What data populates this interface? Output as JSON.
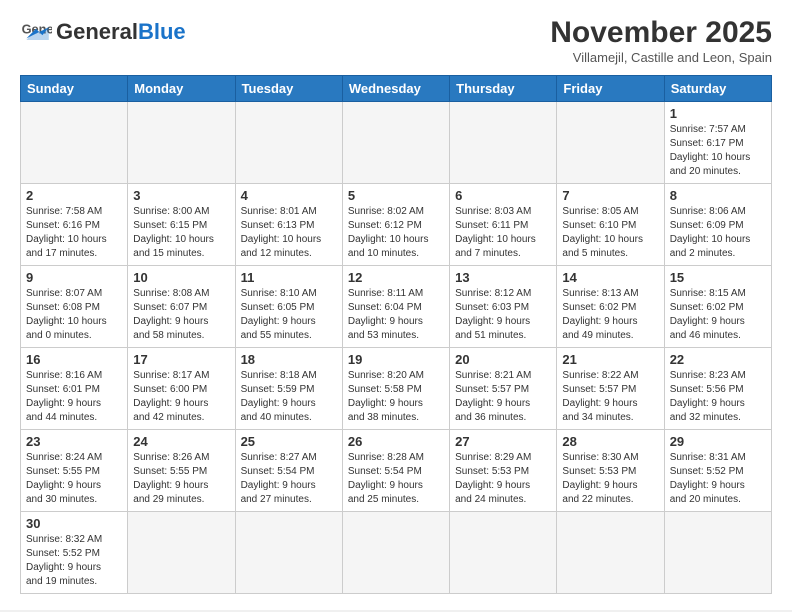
{
  "header": {
    "logo_general": "General",
    "logo_blue": "Blue",
    "month_title": "November 2025",
    "subtitle": "Villamejil, Castille and Leon, Spain"
  },
  "days_of_week": [
    "Sunday",
    "Monday",
    "Tuesday",
    "Wednesday",
    "Thursday",
    "Friday",
    "Saturday"
  ],
  "weeks": [
    [
      {
        "day": null,
        "info": ""
      },
      {
        "day": null,
        "info": ""
      },
      {
        "day": null,
        "info": ""
      },
      {
        "day": null,
        "info": ""
      },
      {
        "day": null,
        "info": ""
      },
      {
        "day": null,
        "info": ""
      },
      {
        "day": "1",
        "info": "Sunrise: 7:57 AM\nSunset: 6:17 PM\nDaylight: 10 hours\nand 20 minutes."
      }
    ],
    [
      {
        "day": "2",
        "info": "Sunrise: 7:58 AM\nSunset: 6:16 PM\nDaylight: 10 hours\nand 17 minutes."
      },
      {
        "day": "3",
        "info": "Sunrise: 8:00 AM\nSunset: 6:15 PM\nDaylight: 10 hours\nand 15 minutes."
      },
      {
        "day": "4",
        "info": "Sunrise: 8:01 AM\nSunset: 6:13 PM\nDaylight: 10 hours\nand 12 minutes."
      },
      {
        "day": "5",
        "info": "Sunrise: 8:02 AM\nSunset: 6:12 PM\nDaylight: 10 hours\nand 10 minutes."
      },
      {
        "day": "6",
        "info": "Sunrise: 8:03 AM\nSunset: 6:11 PM\nDaylight: 10 hours\nand 7 minutes."
      },
      {
        "day": "7",
        "info": "Sunrise: 8:05 AM\nSunset: 6:10 PM\nDaylight: 10 hours\nand 5 minutes."
      },
      {
        "day": "8",
        "info": "Sunrise: 8:06 AM\nSunset: 6:09 PM\nDaylight: 10 hours\nand 2 minutes."
      }
    ],
    [
      {
        "day": "9",
        "info": "Sunrise: 8:07 AM\nSunset: 6:08 PM\nDaylight: 10 hours\nand 0 minutes."
      },
      {
        "day": "10",
        "info": "Sunrise: 8:08 AM\nSunset: 6:07 PM\nDaylight: 9 hours\nand 58 minutes."
      },
      {
        "day": "11",
        "info": "Sunrise: 8:10 AM\nSunset: 6:05 PM\nDaylight: 9 hours\nand 55 minutes."
      },
      {
        "day": "12",
        "info": "Sunrise: 8:11 AM\nSunset: 6:04 PM\nDaylight: 9 hours\nand 53 minutes."
      },
      {
        "day": "13",
        "info": "Sunrise: 8:12 AM\nSunset: 6:03 PM\nDaylight: 9 hours\nand 51 minutes."
      },
      {
        "day": "14",
        "info": "Sunrise: 8:13 AM\nSunset: 6:02 PM\nDaylight: 9 hours\nand 49 minutes."
      },
      {
        "day": "15",
        "info": "Sunrise: 8:15 AM\nSunset: 6:02 PM\nDaylight: 9 hours\nand 46 minutes."
      }
    ],
    [
      {
        "day": "16",
        "info": "Sunrise: 8:16 AM\nSunset: 6:01 PM\nDaylight: 9 hours\nand 44 minutes."
      },
      {
        "day": "17",
        "info": "Sunrise: 8:17 AM\nSunset: 6:00 PM\nDaylight: 9 hours\nand 42 minutes."
      },
      {
        "day": "18",
        "info": "Sunrise: 8:18 AM\nSunset: 5:59 PM\nDaylight: 9 hours\nand 40 minutes."
      },
      {
        "day": "19",
        "info": "Sunrise: 8:20 AM\nSunset: 5:58 PM\nDaylight: 9 hours\nand 38 minutes."
      },
      {
        "day": "20",
        "info": "Sunrise: 8:21 AM\nSunset: 5:57 PM\nDaylight: 9 hours\nand 36 minutes."
      },
      {
        "day": "21",
        "info": "Sunrise: 8:22 AM\nSunset: 5:57 PM\nDaylight: 9 hours\nand 34 minutes."
      },
      {
        "day": "22",
        "info": "Sunrise: 8:23 AM\nSunset: 5:56 PM\nDaylight: 9 hours\nand 32 minutes."
      }
    ],
    [
      {
        "day": "23",
        "info": "Sunrise: 8:24 AM\nSunset: 5:55 PM\nDaylight: 9 hours\nand 30 minutes."
      },
      {
        "day": "24",
        "info": "Sunrise: 8:26 AM\nSunset: 5:55 PM\nDaylight: 9 hours\nand 29 minutes."
      },
      {
        "day": "25",
        "info": "Sunrise: 8:27 AM\nSunset: 5:54 PM\nDaylight: 9 hours\nand 27 minutes."
      },
      {
        "day": "26",
        "info": "Sunrise: 8:28 AM\nSunset: 5:54 PM\nDaylight: 9 hours\nand 25 minutes."
      },
      {
        "day": "27",
        "info": "Sunrise: 8:29 AM\nSunset: 5:53 PM\nDaylight: 9 hours\nand 24 minutes."
      },
      {
        "day": "28",
        "info": "Sunrise: 8:30 AM\nSunset: 5:53 PM\nDaylight: 9 hours\nand 22 minutes."
      },
      {
        "day": "29",
        "info": "Sunrise: 8:31 AM\nSunset: 5:52 PM\nDaylight: 9 hours\nand 20 minutes."
      }
    ],
    [
      {
        "day": "30",
        "info": "Sunrise: 8:32 AM\nSunset: 5:52 PM\nDaylight: 9 hours\nand 19 minutes."
      },
      {
        "day": null,
        "info": ""
      },
      {
        "day": null,
        "info": ""
      },
      {
        "day": null,
        "info": ""
      },
      {
        "day": null,
        "info": ""
      },
      {
        "day": null,
        "info": ""
      },
      {
        "day": null,
        "info": ""
      }
    ]
  ]
}
